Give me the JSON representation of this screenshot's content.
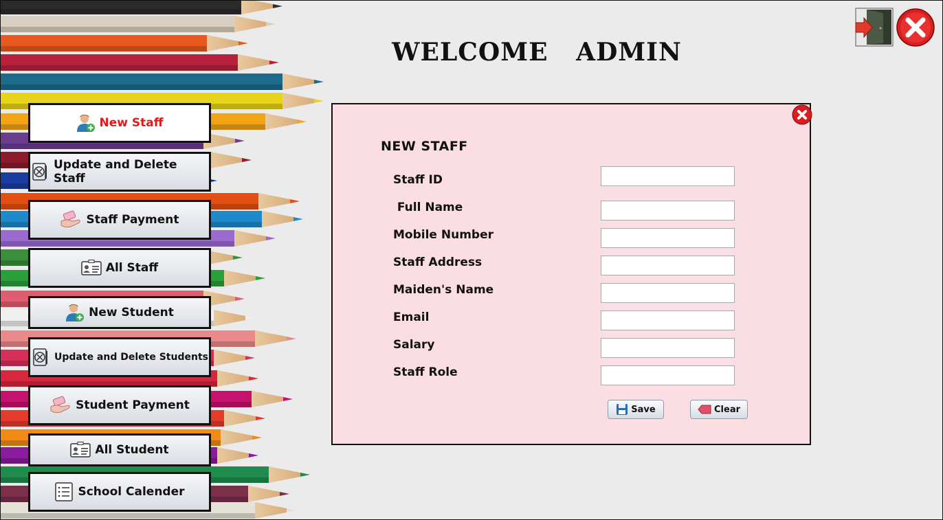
{
  "header": {
    "title": "WELCOME   ADMIN"
  },
  "top_controls": {
    "logout_icon": "logout-door-icon",
    "close_icon": "red-close-icon"
  },
  "nav": {
    "items": [
      {
        "label": "New Staff",
        "icon": "add-user-icon",
        "active": true
      },
      {
        "label": "Update and Delete Staff",
        "icon": "edit-delete-icon"
      },
      {
        "label": "Staff Payment",
        "icon": "payment-hand-icon"
      },
      {
        "label": "All Staff",
        "icon": "id-card-icon"
      },
      {
        "label": "New Student",
        "icon": "add-user-icon"
      },
      {
        "label": "Update and Delete Students",
        "icon": "edit-delete-icon"
      },
      {
        "label": "Student Payment",
        "icon": "payment-hand-icon"
      },
      {
        "label": "All Student",
        "icon": "id-card-icon"
      },
      {
        "label": "School Calender",
        "icon": "list-icon"
      }
    ]
  },
  "form": {
    "title": "NEW STAFF",
    "fields": [
      {
        "label": "Staff ID",
        "value": ""
      },
      {
        "label": " Full Name",
        "value": ""
      },
      {
        "label": "Mobile Number",
        "value": ""
      },
      {
        "label": "Staff Address",
        "value": ""
      },
      {
        "label": "Maiden's Name",
        "value": ""
      },
      {
        "label": "Email",
        "value": ""
      },
      {
        "label": "Salary",
        "value": ""
      },
      {
        "label": "Staff Role",
        "value": ""
      }
    ],
    "save_label": "Save",
    "clear_label": "Clear"
  },
  "colors": {
    "panel_bg": "#fbdde4",
    "active_text": "#e31a1a",
    "page_bg": "#ebebeb"
  }
}
